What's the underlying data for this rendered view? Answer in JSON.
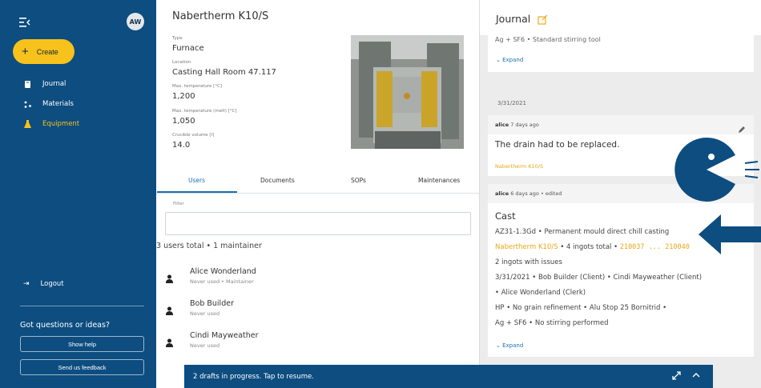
{
  "sidebar": {
    "avatar_initials": "AW",
    "create_label": "Create",
    "nav": [
      {
        "label": "Journal",
        "icon": "book-icon",
        "active": false
      },
      {
        "label": "Materials",
        "icon": "molecule-icon",
        "active": false
      },
      {
        "label": "Equipment",
        "icon": "flask-icon",
        "active": true
      }
    ],
    "logout_label": "Logout",
    "questions": "Got questions or ideas?",
    "show_help": "Show help",
    "feedback": "Send us feedback"
  },
  "equipment": {
    "title": "Nabertherm K10/S",
    "fields": [
      {
        "label": "Type",
        "value": "Furnace"
      },
      {
        "label": "Location",
        "value": "Casting Hall Room 47.117"
      },
      {
        "label": "Max. temperature [°C]",
        "value": "1,200"
      },
      {
        "label": "Max. temperature (melt) [°C]",
        "value": "1,050"
      },
      {
        "label": "Crucible volume [l]",
        "value": "14.0"
      }
    ],
    "tabs": [
      "Users",
      "Documents",
      "SOPs",
      "Maintenances"
    ],
    "active_tab": "Users",
    "filter_label": "Filter",
    "filter_value": "",
    "users_summary": "3 users total  •  1 maintainer",
    "users": [
      {
        "name": "Alice Wonderland",
        "meta": "Never used • Maintainer"
      },
      {
        "name": "Bob Builder",
        "meta": "Never used"
      },
      {
        "name": "Cindi Mayweather",
        "meta": "Never used"
      }
    ]
  },
  "journal": {
    "title": "Journal",
    "top_card": {
      "line": "Ag + SF6  •  Standard stirring tool",
      "expand": "Expand"
    },
    "date": "3/31/2021",
    "entry1": {
      "author": "alice",
      "when": "7 days ago",
      "text": "The drain had to be replaced.",
      "tag": "Nabertherm K10/S"
    },
    "entry2": {
      "author": "alice",
      "when": "6 days ago • edited",
      "title": "Cast",
      "line1": "AZ31-1.3Gd  •  Permanent mould direct chill casting",
      "line2_link": "Nabertherm K10/S",
      "line2_mid": "  •  4 ingots total  •  ",
      "line2_ids": "210037 ... 210040",
      "line3": "2 ingots with issues",
      "line4": "3/31/2021  •  Bob Builder (Client)  •  Cindi Mayweather (Client)",
      "line5": "•  Alice Wonderland (Clerk)",
      "line6": "HP  •  No grain refinement  •  Alu Stop 25 Bornitrid  •",
      "line7": "Ag + SF6  •  No stirring performed",
      "expand": "Expand"
    }
  },
  "drafts": {
    "text": "2 drafts in progress. Tap to resume."
  },
  "colors": {
    "sidebar": "#0d4d80",
    "accent": "#f6c21b",
    "link": "#1a6fb0",
    "tag": "#e6a817"
  }
}
